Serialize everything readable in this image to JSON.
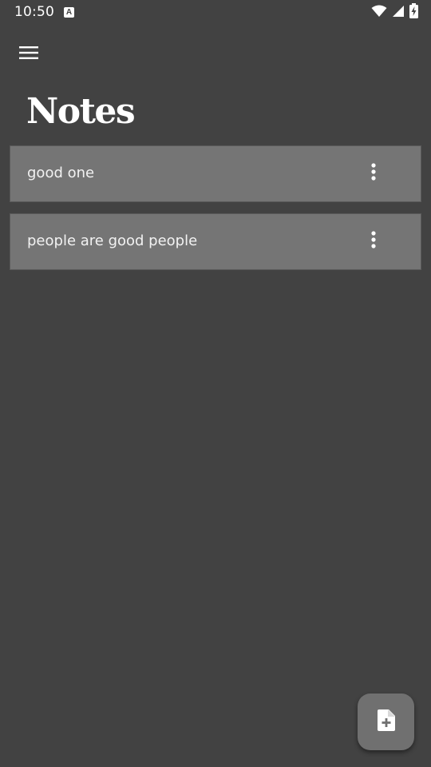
{
  "status_bar": {
    "time": "10:50",
    "notification_icon": "a-icon",
    "icons": [
      "wifi-icon",
      "cell-signal-icon",
      "battery-charging-icon"
    ]
  },
  "app_bar": {
    "menu_icon": "hamburger-menu-icon",
    "title": "Notes"
  },
  "notes": [
    {
      "text": "good one",
      "menu_icon": "more-vert-icon"
    },
    {
      "text": "people are good people",
      "menu_icon": "more-vert-icon"
    }
  ],
  "fab": {
    "icon": "note-add-icon"
  },
  "colors": {
    "background": "#424242",
    "card": "#757575",
    "fab": "#707070",
    "text": "#ffffff"
  }
}
